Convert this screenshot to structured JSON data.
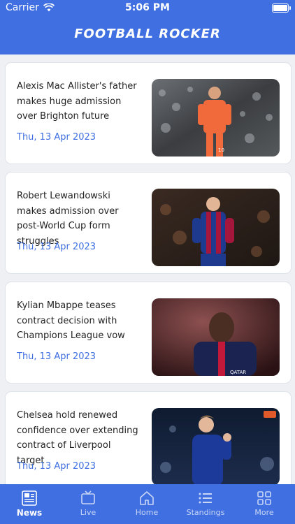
{
  "status_bar": {
    "carrier": "Carrier",
    "time": "5:06 PM"
  },
  "app": {
    "title": "FOOTBALL ROCKER"
  },
  "news": [
    {
      "title": "Alexis Mac Allister's father makes huge admission over Brighton future",
      "date": "Thu, 13 Apr 2023",
      "image": "player-orange-kit"
    },
    {
      "title": "Robert Lewandowski makes admission over post-World Cup form struggles",
      "date": "Thu, 13 Apr 2023",
      "image": "player-barcelona-kit"
    },
    {
      "title": "Kylian Mbappe teases contract decision with Champions League vow",
      "date": "Thu, 13 Apr 2023",
      "image": "player-psg-kit"
    },
    {
      "title": "Chelsea hold renewed confidence over extending contract of Liverpool target",
      "date": "Thu, 13 Apr 2023",
      "image": "player-chelsea-kit"
    }
  ],
  "tabs": [
    {
      "label": "News",
      "icon": "newspaper-icon",
      "active": true
    },
    {
      "label": "Live",
      "icon": "tv-icon",
      "active": false
    },
    {
      "label": "Home",
      "icon": "home-icon",
      "active": false
    },
    {
      "label": "Standings",
      "icon": "list-icon",
      "active": false
    },
    {
      "label": "More",
      "icon": "grid-icon",
      "active": false
    }
  ],
  "colors": {
    "brand": "#3f6fe0",
    "background": "#eef0f4",
    "date": "#3f6fe0"
  }
}
